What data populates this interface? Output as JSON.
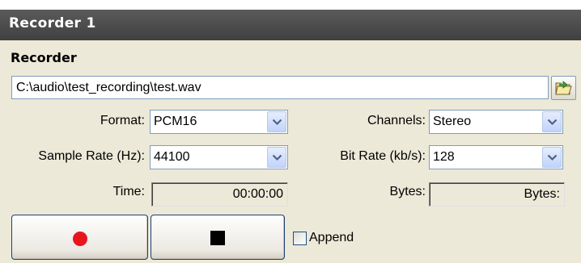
{
  "window": {
    "title": "Recorder 1"
  },
  "section": {
    "label": "Recorder"
  },
  "file": {
    "path": "C:\\audio\\test_recording\\test.wav",
    "browse_icon": "open-folder-icon"
  },
  "format": {
    "label": "Format:",
    "value": "PCM16"
  },
  "channels": {
    "label": "Channels:",
    "value": "Stereo"
  },
  "sample_rate": {
    "label": "Sample Rate (Hz):",
    "value": "44100"
  },
  "bit_rate": {
    "label": "Bit Rate (kb/s):",
    "value": "128"
  },
  "time": {
    "label": "Time:",
    "value": "00:00:00"
  },
  "bytes": {
    "label": "Bytes:",
    "value": "Bytes:"
  },
  "controls": {
    "record_icon": "record-icon",
    "stop_icon": "stop-icon",
    "record_color": "#e8141e",
    "stop_color": "#000000"
  },
  "append": {
    "label": "Append",
    "checked": false
  },
  "colors": {
    "titlebar": "#4a4a4a",
    "panel": "#ece9d8",
    "field_border": "#7f9db9"
  }
}
